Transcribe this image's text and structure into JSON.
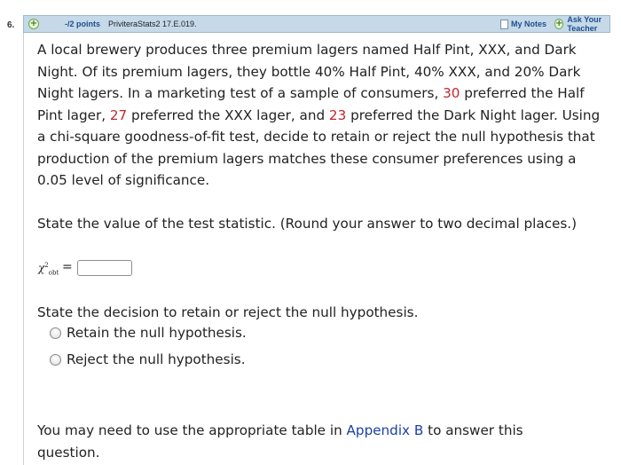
{
  "question": {
    "number": "6.",
    "points": "-/2 points",
    "source": "PriviteraStats2 17.E.019.",
    "my_notes": "My Notes",
    "ask_teacher": "Ask Your Teacher"
  },
  "problem": {
    "part1": "A local brewery produces three premium lagers named Half Pint, XXX, and Dark Night. Of its premium lagers, they bottle 40% Half Pint, 40% XXX, and 20% Dark Night lagers. In a marketing test of a sample of consumers, ",
    "n1": "30",
    "part2": " preferred the Half Pint lager, ",
    "n2": "27",
    "part3": " preferred the XXX lager, and ",
    "n3": "23",
    "part4": " preferred the Dark Night lager. Using a chi-square goodness-of-fit test, decide to retain or reject the null hypothesis that production of the premium lagers matches these consumer preferences using a 0.05 level of significance."
  },
  "q1": {
    "prompt": "State the value of the test statistic. (Round your answer to two decimal places.)",
    "symbol": "χ",
    "sup": "2",
    "sub": "obt",
    "equals": "=",
    "answer": ""
  },
  "q2": {
    "prompt": "State the decision to retain or reject the null hypothesis.",
    "options": [
      "Retain the null hypothesis.",
      "Reject the null hypothesis."
    ]
  },
  "footer": {
    "text1": "You may need to use the appropriate table in ",
    "link": "Appendix B",
    "text2": " to answer this question."
  }
}
